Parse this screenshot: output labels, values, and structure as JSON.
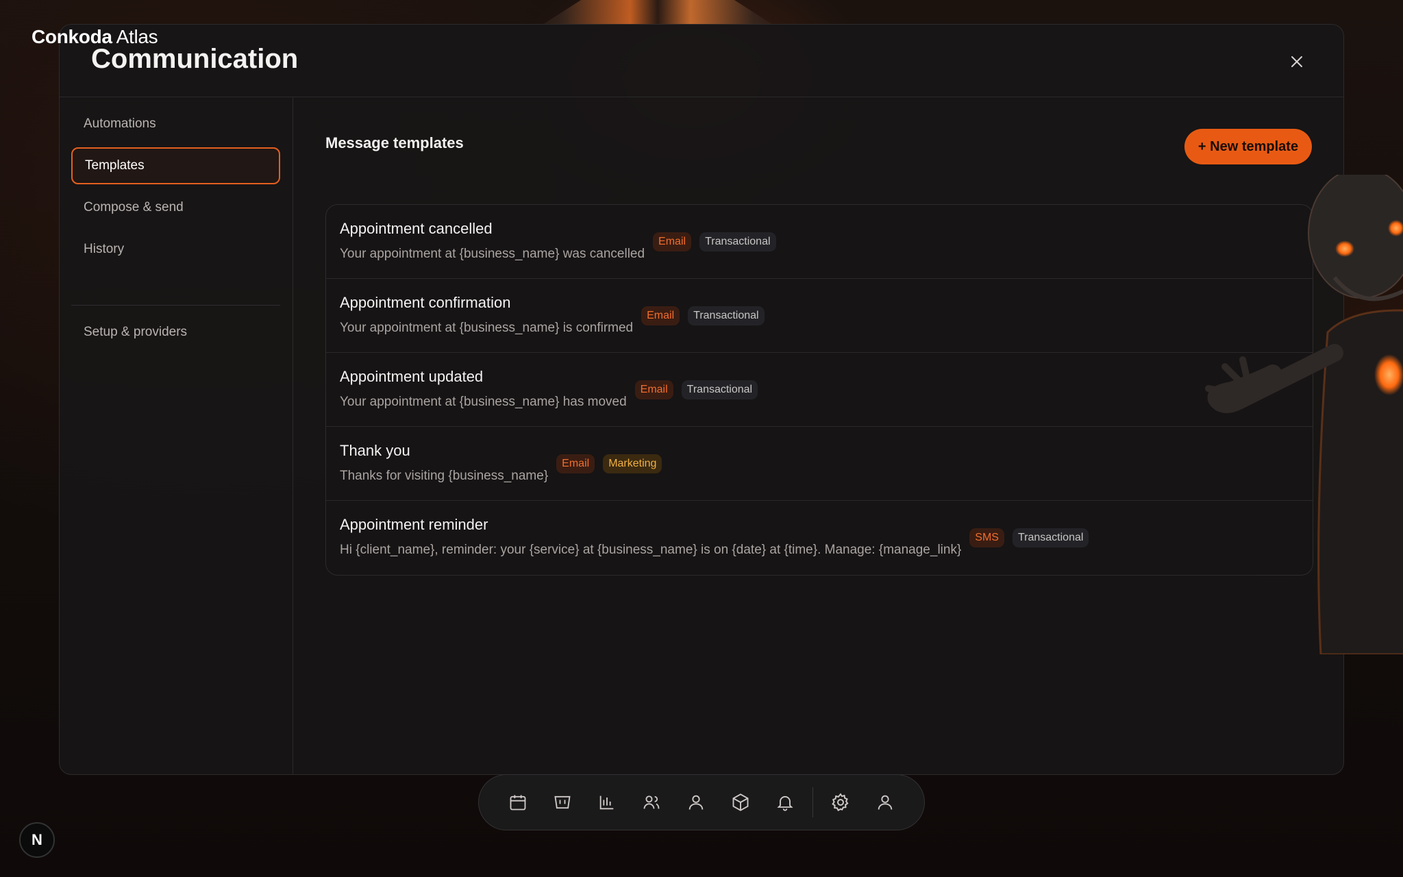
{
  "brand": {
    "bold": "Conkoda",
    "light": "Atlas"
  },
  "panel": {
    "title": "Communication"
  },
  "sidebar": {
    "items": [
      {
        "label": "Automations",
        "active": false
      },
      {
        "label": "Templates",
        "active": true
      },
      {
        "label": "Compose & send",
        "active": false
      },
      {
        "label": "History",
        "active": false
      },
      {
        "label": "Setup & providers",
        "active": false
      }
    ]
  },
  "main": {
    "section_title": "Message templates",
    "new_button_label": "+ New template",
    "templates": [
      {
        "name": "Appointment cancelled",
        "preview": "Your appointment at {business_name} was cancelled",
        "channel": "Email",
        "category": "Transactional"
      },
      {
        "name": "Appointment confirmation",
        "preview": "Your appointment at {business_name} is confirmed",
        "channel": "Email",
        "category": "Transactional"
      },
      {
        "name": "Appointment updated",
        "preview": "Your appointment at {business_name} has moved",
        "channel": "Email",
        "category": "Transactional"
      },
      {
        "name": "Thank you",
        "preview": "Thanks for visiting {business_name}",
        "channel": "Email",
        "category": "Marketing"
      },
      {
        "name": "Appointment reminder",
        "preview": "Hi {client_name}, reminder: your {service} at {business_name} is on {date} at {time}. Manage: {manage_link}",
        "channel": "SMS",
        "category": "Transactional"
      }
    ]
  },
  "dock": {
    "icons": [
      "calendar-icon",
      "register-icon",
      "bar-chart-icon",
      "team-icon",
      "person-icon",
      "box-icon",
      "bell-icon",
      "gear-icon",
      "user-icon"
    ]
  },
  "corner_badge": {
    "label": "N"
  },
  "colors": {
    "accent": "#e85a13",
    "panel_bg": "#181617",
    "marketing": "#f0b044"
  }
}
